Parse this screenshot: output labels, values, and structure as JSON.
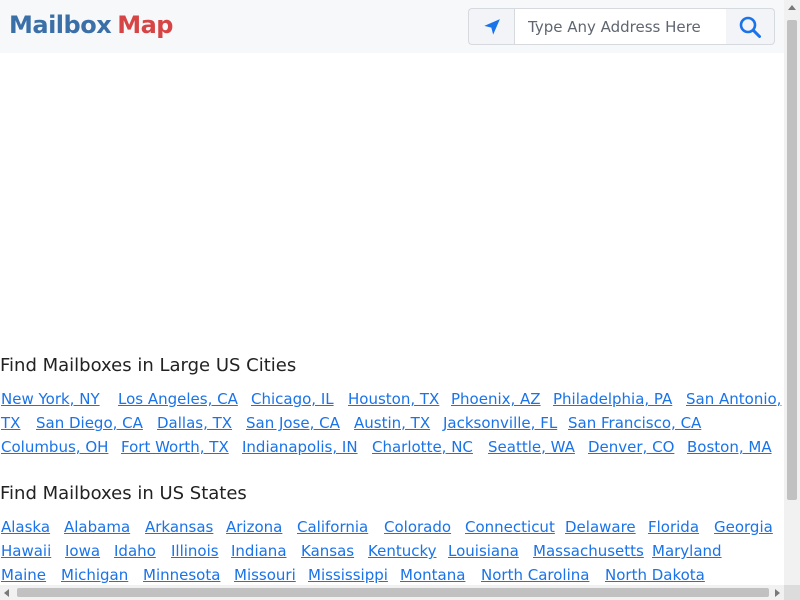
{
  "header": {
    "logo_word1": "Mailbox",
    "logo_word2": "Map",
    "search_placeholder": "Type Any Address Here",
    "locate_icon": "location-arrow-icon",
    "search_icon": "search-icon"
  },
  "cities": {
    "title": "Find Mailboxes in Large US Cities",
    "rows": [
      [
        "New York, NY",
        "Los Angeles, CA",
        "Chicago, IL",
        "Houston, TX",
        "Phoenix, AZ",
        "Philadelphia, PA",
        "San Antonio,"
      ],
      [
        "TX",
        "San Diego, CA",
        "Dallas, TX",
        "San Jose, CA",
        "Austin, TX",
        "Jacksonville, FL",
        "San Francisco, CA"
      ],
      [
        "Columbus, OH",
        "Fort Worth, TX",
        "Indianapolis, IN",
        "Charlotte, NC",
        "Seattle, WA",
        "Denver, CO",
        "Boston, MA"
      ]
    ]
  },
  "states": {
    "title": "Find Mailboxes in US States",
    "rows": [
      [
        "Alaska",
        "Alabama",
        "Arkansas",
        "Arizona",
        "California",
        "Colorado",
        "Connecticut",
        "Delaware",
        "Florida",
        "Georgia"
      ],
      [
        "Hawaii",
        "Iowa",
        "Idaho",
        "Illinois",
        "Indiana",
        "Kansas",
        "Kentucky",
        "Louisiana",
        "Massachusetts",
        "Maryland"
      ],
      [
        "Maine",
        "Michigan",
        "Minnesota",
        "Missouri",
        "Mississippi",
        "Montana",
        "North Carolina",
        "North Dakota"
      ]
    ]
  },
  "colors": {
    "logo_blue": "#3b6fa8",
    "logo_red": "#d64545",
    "link": "#1a73e8",
    "header_bg": "#f7f8fa",
    "icon_blue": "#1a73e8"
  }
}
